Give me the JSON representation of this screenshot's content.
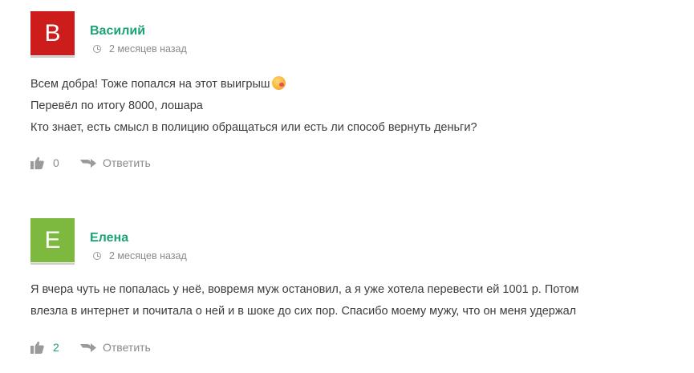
{
  "comments": [
    {
      "avatar_letter": "В",
      "avatar_color": "#cc1c1c",
      "author": "Василий",
      "time": "2 месяцев назад",
      "lines": [
        "Всем добра! Тоже попался на этот выигрыш",
        "Перевёл по итогу 8000, лошара",
        "Кто знает, есть смысл в полицию обращаться или есть ли способ вернуть деньги?"
      ],
      "likes": "0",
      "reply_label": "Ответить"
    },
    {
      "avatar_letter": "Е",
      "avatar_color": "#7cb93e",
      "author": "Елена",
      "time": "2 месяцев назад",
      "lines": [
        "Я вчера чуть не попалась у неё, вовремя муж остановил, а я уже хотела перевести ей 1001 р. Потом",
        "влезла в интернет и почитала о ней и в шоке до сих пор. Спасибо моему мужу, что он меня удержал"
      ],
      "likes": "2",
      "reply_label": "Ответить"
    }
  ],
  "icons": {
    "time": "clock-icon",
    "like": "thumbs-up-icon",
    "reply": "reply-arrow-icon",
    "emoji": "dizzy-face-emoji-icon"
  },
  "colors": {
    "author": "#1aa377",
    "positive_likes": "#1aa377",
    "muted": "#8a8a8a"
  }
}
